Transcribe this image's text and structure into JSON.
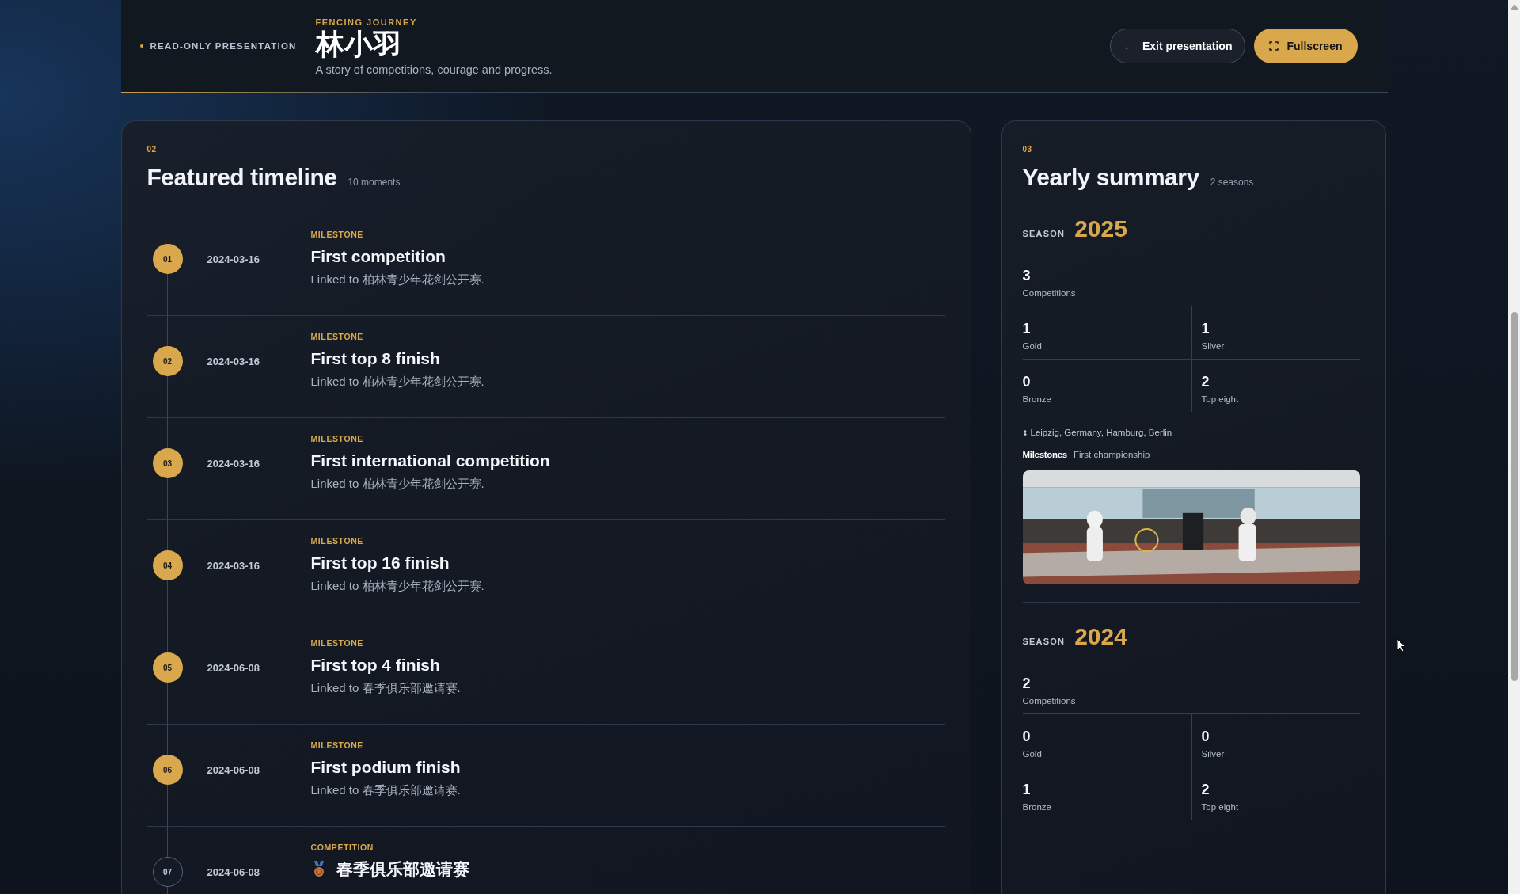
{
  "header": {
    "mode_label": "READ-ONLY PRESENTATION",
    "eyebrow": "FENCING JOURNEY",
    "name": "林小羽",
    "tagline": "A story of competitions, courage and progress.",
    "buttons": [
      {
        "kind": "secondary",
        "icon": "←",
        "label": "Exit presentation"
      },
      {
        "kind": "primary",
        "label": "Fullscreen"
      }
    ]
  },
  "timeline": {
    "number": "02",
    "title": "Featured timeline",
    "count": "10 moments",
    "items": [
      {
        "index": "01",
        "date": "2024-03-16",
        "kind": "milestone",
        "type_label": "MILESTONE",
        "title": "First competition",
        "note": "Linked to 柏林青少年花剑公开赛."
      },
      {
        "index": "02",
        "date": "2024-03-16",
        "kind": "milestone",
        "type_label": "MILESTONE",
        "title": "First top 8 finish",
        "note": "Linked to 柏林青少年花剑公开赛."
      },
      {
        "index": "03",
        "date": "2024-03-16",
        "kind": "milestone",
        "type_label": "MILESTONE",
        "title": "First international competition",
        "note": "Linked to 柏林青少年花剑公开赛."
      },
      {
        "index": "04",
        "date": "2024-03-16",
        "kind": "milestone",
        "type_label": "MILESTONE",
        "title": "First top 16 finish",
        "note": "Linked to 柏林青少年花剑公开赛."
      },
      {
        "index": "05",
        "date": "2024-06-08",
        "kind": "milestone",
        "type_label": "MILESTONE",
        "title": "First top 4 finish",
        "note": "Linked to 春季俱乐部邀请赛."
      },
      {
        "index": "06",
        "date": "2024-06-08",
        "kind": "milestone",
        "type_label": "MILESTONE",
        "title": "First podium finish",
        "note": "Linked to 春季俱乐部邀请赛."
      },
      {
        "index": "07",
        "date": "2024-06-08",
        "kind": "competition",
        "type_label": "COMPETITION",
        "color": "#c8733e",
        "title": "春季俱乐部邀请赛"
      }
    ]
  },
  "summary": {
    "number": "03",
    "title": "Yearly summary",
    "count": "2 seasons",
    "seasons": [
      {
        "label": "SEASON",
        "year": "2025",
        "total": {
          "value": "3",
          "label": "Competitions"
        },
        "stats": [
          {
            "value": "1",
            "label": "Gold"
          },
          {
            "value": "1",
            "label": "Silver"
          },
          {
            "value": "0",
            "label": "Bronze"
          },
          {
            "value": "2",
            "label": "Top eight"
          }
        ],
        "places": "Leipzig, Germany, Hamburg, Berlin",
        "milestones_label": "Milestones",
        "milestones": "First championship"
      },
      {
        "label": "SEASON",
        "year": "2024",
        "total": {
          "value": "2",
          "label": "Competitions"
        },
        "stats": [
          {
            "value": "0",
            "label": "Gold"
          },
          {
            "value": "0",
            "label": "Silver"
          },
          {
            "value": "1",
            "label": "Bronze"
          },
          {
            "value": "2",
            "label": "Top eight"
          }
        ]
      }
    ]
  }
}
